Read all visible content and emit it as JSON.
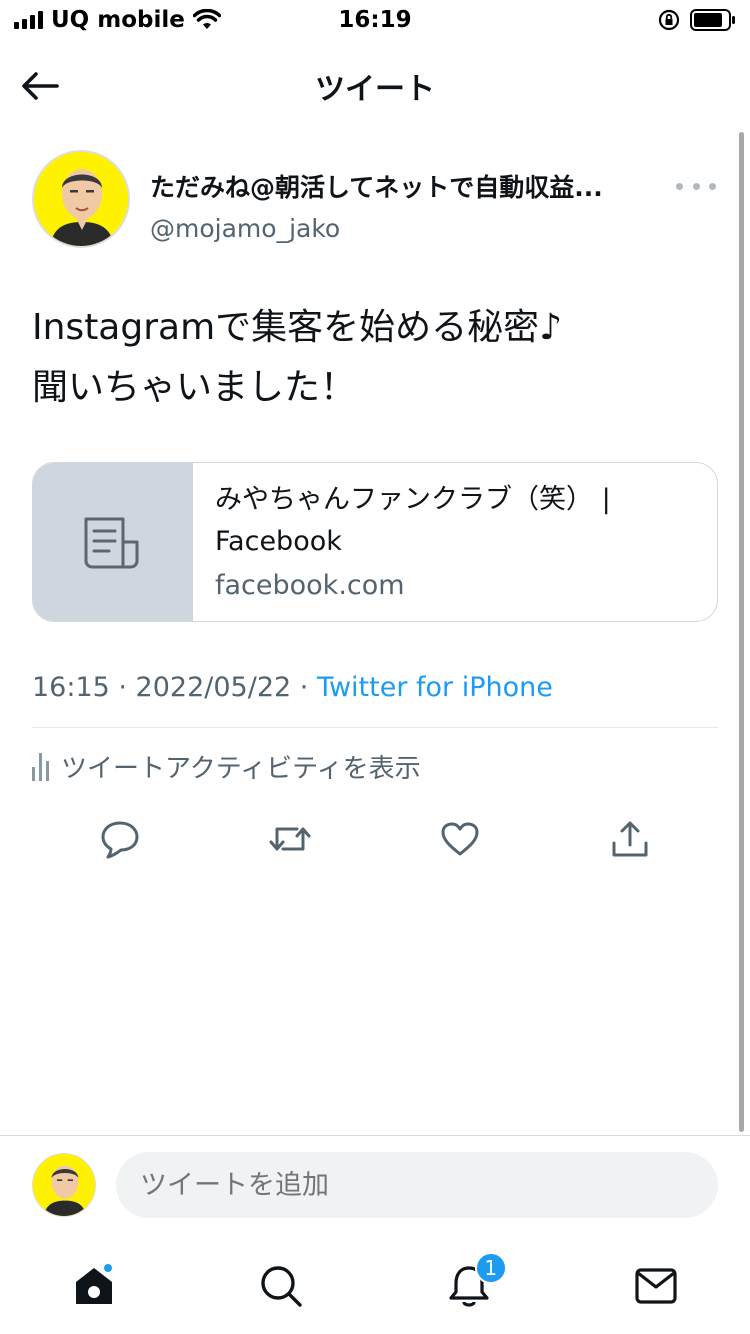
{
  "status_bar": {
    "carrier": "UQ mobile",
    "time": "16:19"
  },
  "header": {
    "title": "ツイート"
  },
  "tweet": {
    "author": {
      "display_name": "ただみね@朝活してネットで自動収益...",
      "handle": "@mojamo_jako"
    },
    "text": "Instagramで集客を始める秘密♪\n聞いちゃいました！",
    "link_card": {
      "title": "みやちゃんファンクラブ（笑） | Facebook",
      "domain": "facebook.com"
    },
    "meta": {
      "datetime": "16:15 · 2022/05/22 · ",
      "source": "Twitter for iPhone"
    },
    "activity_label": "ツイートアクティビティを表示"
  },
  "reply": {
    "placeholder": "ツイートを追加"
  },
  "tabbar": {
    "notifications_badge": "1"
  },
  "colors": {
    "accent": "#1d9bf0",
    "text": "#0f1419",
    "secondary": "#536471"
  }
}
